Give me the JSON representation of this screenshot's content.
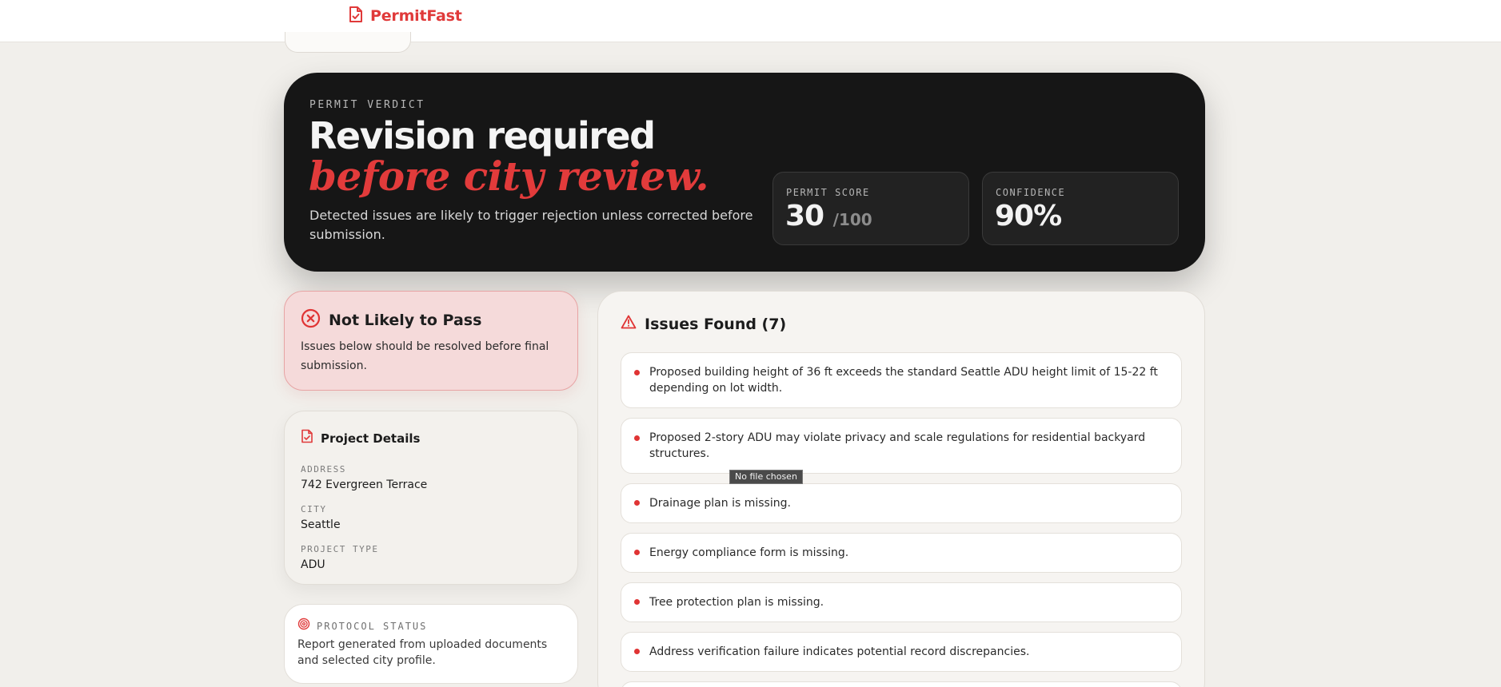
{
  "brand": {
    "name": "PermitFast",
    "color": "#e03a3a",
    "icon": "document-check-icon"
  },
  "verdict": {
    "eyebrow": "PERMIT VERDICT",
    "title_line1": "Revision required",
    "title_line2": "before city review.",
    "description": "Detected issues are likely to trigger rejection unless corrected before submission.",
    "score_label": "PERMIT SCORE",
    "score_value": "30",
    "score_suffix": "/100",
    "confidence_label": "CONFIDENCE",
    "confidence_value": "90%"
  },
  "status_card": {
    "icon": "x-circle-icon",
    "title": "Not Likely to Pass",
    "text": "Issues below should be resolved before final submission."
  },
  "project_details": {
    "icon": "document-icon",
    "title": "Project Details",
    "fields": [
      {
        "label": "ADDRESS",
        "value": "742 Evergreen Terrace"
      },
      {
        "label": "CITY",
        "value": "Seattle"
      },
      {
        "label": "PROJECT TYPE",
        "value": "ADU"
      }
    ]
  },
  "protocol": {
    "icon": "fingerprint-icon",
    "title": "PROTOCOL STATUS",
    "text": "Report generated from uploaded documents and selected city profile."
  },
  "issues": {
    "icon": "warning-triangle-icon",
    "title": "Issues Found (7)",
    "items": [
      "Proposed building height of 36 ft exceeds the standard Seattle ADU height limit of 15-22 ft depending on lot width.",
      "Proposed 2-story ADU may violate privacy and scale regulations for residential backyard structures.",
      "Drainage plan is missing.",
      "Energy compliance form is missing.",
      "Tree protection plan is missing.",
      "Address verification failure indicates potential record discrepancies."
    ]
  },
  "tooltip": {
    "text": "No file chosen"
  },
  "colors": {
    "accent": "#e03a3a",
    "dark_panel": "#161616",
    "background": "#f1efeb",
    "fail_bg": "#f5dada"
  }
}
